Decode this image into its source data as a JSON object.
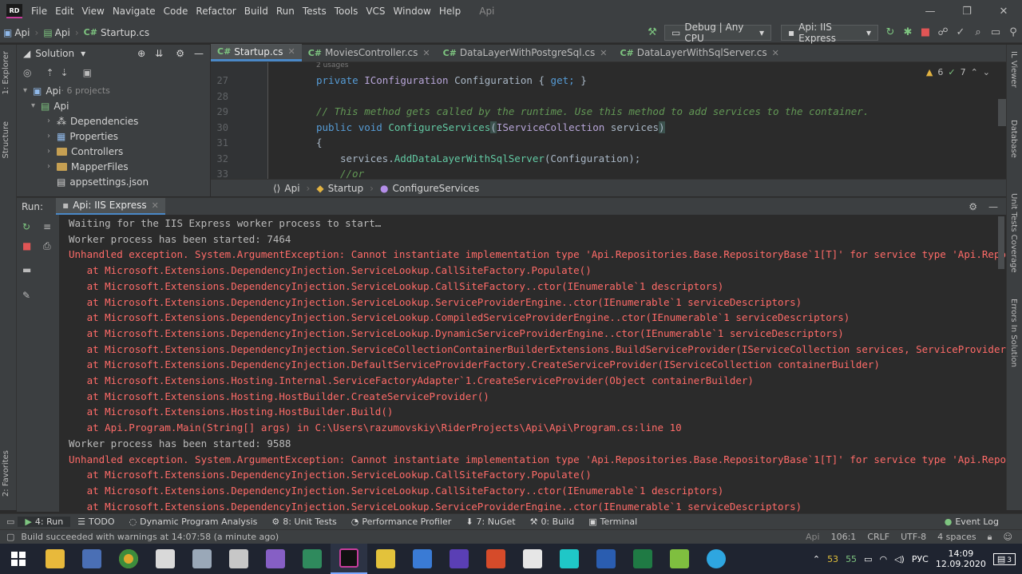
{
  "menubar": {
    "logo": "RD",
    "items": [
      "File",
      "Edit",
      "View",
      "Navigate",
      "Code",
      "Refactor",
      "Build",
      "Run",
      "Tests",
      "Tools",
      "VCS",
      "Window",
      "Help"
    ],
    "app_title": "Api"
  },
  "navbar": {
    "crumbs": [
      "Api",
      "Api",
      "Startup.cs"
    ],
    "config": "Debug | Any CPU",
    "run_config": "Api: IIS Express"
  },
  "left_strip": {
    "tabs": [
      "1: Explorer",
      "Structure",
      "2: Favorites"
    ]
  },
  "right_strip": {
    "tabs": [
      "IL Viewer",
      "Database",
      "Unit Tests Coverage",
      "Errors In Solution"
    ]
  },
  "solution": {
    "header": "Solution",
    "tree": [
      {
        "label": "Api",
        "extra": " · 6 projects"
      },
      {
        "label": "Api"
      },
      {
        "label": "Dependencies"
      },
      {
        "label": "Properties"
      },
      {
        "label": "Controllers"
      },
      {
        "label": "MapperFiles"
      },
      {
        "label": "appsettings.json"
      }
    ]
  },
  "tabs": [
    {
      "label": "Startup.cs"
    },
    {
      "label": "MoviesController.cs"
    },
    {
      "label": "DataLayerWithPostgreSql.cs"
    },
    {
      "label": "DataLayerWithSqlServer.cs"
    }
  ],
  "editor": {
    "usages": "2 usages",
    "line_numbers": [
      "27",
      "28",
      "29",
      "30",
      "31",
      "32",
      "33"
    ],
    "line27": {
      "kw": "private",
      "type": "IConfiguration",
      "name": "Configuration",
      "brace1": "{",
      "get": "get;",
      "brace2": "}"
    },
    "line29": "// This method gets called by the runtime. Use this method to add services to the container.",
    "line30": {
      "kw1": "public",
      "kw2": "void",
      "fn": "ConfigureServices",
      "po": "(",
      "type": "IServiceCollection",
      "param": "services",
      "pc": ")"
    },
    "line31": "{",
    "line32": {
      "obj": "services.",
      "fn": "AddDataLayerWithSqlServer",
      "args": "(Configuration);"
    },
    "line33": "//or",
    "warnings": "6",
    "checks": "7"
  },
  "crumbs2": {
    "a": "Api",
    "b": "Startup",
    "c": "ConfigureServices"
  },
  "run": {
    "label": "Run:",
    "tab": "Api: IIS Express"
  },
  "console_lines": [
    {
      "text": "Waiting for the IIS Express worker process to start…",
      "err": false
    },
    {
      "text": "Worker process has been started: 7464",
      "err": false
    },
    {
      "text": "Unhandled exception. System.ArgumentException: Cannot instantiate implementation type 'Api.Repositories.Base.RepositoryBase`1[T]' for service type 'Api.Repos",
      "err": true
    },
    {
      "text": "   at Microsoft.Extensions.DependencyInjection.ServiceLookup.CallSiteFactory.Populate()",
      "err": true
    },
    {
      "text": "   at Microsoft.Extensions.DependencyInjection.ServiceLookup.CallSiteFactory..ctor(IEnumerable`1 descriptors)",
      "err": true
    },
    {
      "text": "   at Microsoft.Extensions.DependencyInjection.ServiceLookup.ServiceProviderEngine..ctor(IEnumerable`1 serviceDescriptors)",
      "err": true
    },
    {
      "text": "   at Microsoft.Extensions.DependencyInjection.ServiceLookup.CompiledServiceProviderEngine..ctor(IEnumerable`1 serviceDescriptors)",
      "err": true
    },
    {
      "text": "   at Microsoft.Extensions.DependencyInjection.ServiceLookup.DynamicServiceProviderEngine..ctor(IEnumerable`1 serviceDescriptors)",
      "err": true
    },
    {
      "text": "   at Microsoft.Extensions.DependencyInjection.ServiceCollectionContainerBuilderExtensions.BuildServiceProvider(IServiceCollection services, ServiceProviderO",
      "err": true
    },
    {
      "text": "   at Microsoft.Extensions.DependencyInjection.DefaultServiceProviderFactory.CreateServiceProvider(IServiceCollection containerBuilder)",
      "err": true
    },
    {
      "text": "   at Microsoft.Extensions.Hosting.Internal.ServiceFactoryAdapter`1.CreateServiceProvider(Object containerBuilder)",
      "err": true
    },
    {
      "text": "   at Microsoft.Extensions.Hosting.HostBuilder.CreateServiceProvider()",
      "err": true
    },
    {
      "text": "   at Microsoft.Extensions.Hosting.HostBuilder.Build()",
      "err": true
    },
    {
      "text": "   at Api.Program.Main(String[] args) in C:\\Users\\razumovskiy\\RiderProjects\\Api\\Api\\Program.cs:line 10",
      "err": true
    },
    {
      "text": "Worker process has been started: 9588",
      "err": false
    },
    {
      "text": "Unhandled exception. System.ArgumentException: Cannot instantiate implementation type 'Api.Repositories.Base.RepositoryBase`1[T]' for service type 'Api.Repos",
      "err": true
    },
    {
      "text": "   at Microsoft.Extensions.DependencyInjection.ServiceLookup.CallSiteFactory.Populate()",
      "err": true
    },
    {
      "text": "   at Microsoft.Extensions.DependencyInjection.ServiceLookup.CallSiteFactory..ctor(IEnumerable`1 descriptors)",
      "err": true
    },
    {
      "text": "   at Microsoft.Extensions.DependencyInjection.ServiceLookup.ServiceProviderEngine..ctor(IEnumerable`1 serviceDescriptors)",
      "err": true
    }
  ],
  "bottom_tabs": [
    {
      "label": "4: Run"
    },
    {
      "label": "TODO"
    },
    {
      "label": "Dynamic Program Analysis"
    },
    {
      "label": "8: Unit Tests"
    },
    {
      "label": "Performance Profiler"
    },
    {
      "label": "7: NuGet"
    },
    {
      "label": "0: Build"
    },
    {
      "label": "Terminal"
    }
  ],
  "event_log": "Event Log",
  "status": {
    "message": "Build succeeded with warnings at 14:07:58 (a minute ago)",
    "project": "Api",
    "position": "106:1",
    "line_ending": "CRLF",
    "encoding": "UTF-8",
    "indent": "4 spaces"
  },
  "taskbar": {
    "tray_a": "53",
    "tray_b": "55",
    "lang": "РУС",
    "time": "14:09",
    "date": "12.09.2020",
    "notifications": "3"
  }
}
